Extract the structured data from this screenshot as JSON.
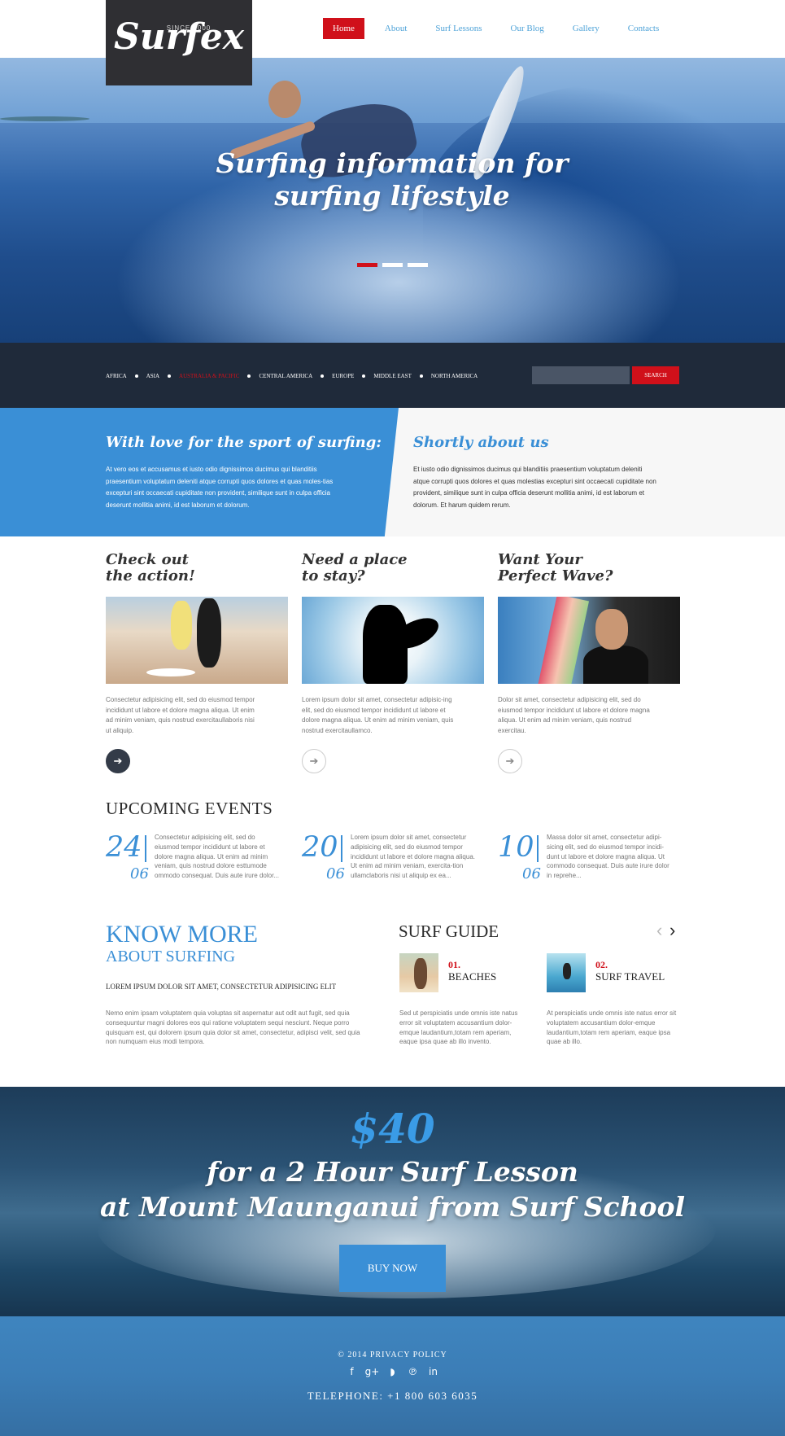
{
  "logo": {
    "since": "SINCE 2000",
    "brand": "Surfex"
  },
  "nav": {
    "items": [
      {
        "label": "Home",
        "active": true
      },
      {
        "label": "About"
      },
      {
        "label": "Surf Lessons"
      },
      {
        "label": "Our Blog"
      },
      {
        "label": "Gallery"
      },
      {
        "label": "Contacts"
      }
    ]
  },
  "hero": {
    "line1": "Surfing information for",
    "line2": "surfing lifestyle",
    "slides": 3,
    "active_slide": 1
  },
  "regions": {
    "items": [
      {
        "label": "AFRICA"
      },
      {
        "label": "ASIA"
      },
      {
        "label": "AUSTRALIA & PACIFIC",
        "active": true
      },
      {
        "label": "CENTRAL AMERICA"
      },
      {
        "label": "EUROPE"
      },
      {
        "label": "MIDDLE EAST"
      },
      {
        "label": "NORTH AMERICA"
      }
    ],
    "search_placeholder": "",
    "search_label": "SEARCH"
  },
  "info": {
    "left_title": "With love for the sport of surfing:",
    "left_text": "At vero eos et accusamus et iusto odio dignissimos ducimus qui blanditiis praesentium voluptatum deleniti atque corrupti quos dolores et quas moles-tias excepturi sint occaecati cupiditate non provident, similique sunt in culpa officia deserunt mollitia animi, id est laborum et dolorum.",
    "right_title": "Shortly about us",
    "right_text": "Et iusto odio dignissimos ducimus qui blanditiis praesentium voluptatum deleniti atque corrupti quos dolores et quas molestias excepturi sint occaecati cupiditate non provident, similique sunt in culpa officia deserunt mollitia animi, id est laborum et dolorum. Et harum quidem rerum."
  },
  "features": [
    {
      "title1": "Check out",
      "title2": "the action!",
      "text": "Consectetur adipisicing elit, sed do eiusmod tempor incididunt ut labore et dolore magna aliqua. Ut enim ad minim veniam, quis nostrud exercitaullaboris nisi ut aliquip."
    },
    {
      "title1": "Need a place",
      "title2": "to stay?",
      "text": "Lorem ipsum dolor sit amet, consectetur adipisic-ing elit, sed do eiusmod tempor incididunt ut labore et dolore magna aliqua. Ut enim ad minim veniam, quis nostrud exercitaullamco."
    },
    {
      "title1": "Want Your",
      "title2": "Perfect Wave?",
      "text": "Dolor sit amet, consectetur adipisicing elit, sed do eiusmod tempor incididunt ut labore et dolore magna aliqua. Ut enim ad minim veniam, quis nostrud exercitau."
    }
  ],
  "events": {
    "title": "UPCOMING EVENTS",
    "items": [
      {
        "day": "24",
        "month": "06",
        "text": "Consectetur adipisicing elit, sed do eiusmod tempor incididunt ut labore et dolore magna aliqua. Ut enim ad minim veniam, quis nostrud dolore esttumode ommodo consequat. Duis aute irure dolor..."
      },
      {
        "day": "20",
        "month": "06",
        "text": "Lorem ipsum dolor sit amet, consectetur adipisicing elit, sed do eiusmod tempor incididunt ut labore et dolore magna aliqua. Ut enim ad minim veniam, exercita-tion ullamclaboris nisi ut aliquip ex ea..."
      },
      {
        "day": "10",
        "month": "06",
        "text": "Massa dolor sit amet, consectetur adipi-sicing elit, sed do eiusmod tempor incidi-dunt ut labore et dolore magna aliqua. Ut commodo consequat. Duis aute irure dolor in reprehe..."
      }
    ]
  },
  "know_more": {
    "title1": "KNOW MORE",
    "title2": "ABOUT SURFING",
    "subtitle": "LOREM IPSUM DOLOR SIT AMET, CONSECTETUR ADIPISICING ELIT",
    "text": "Nemo enim ipsam voluptatem quia voluptas sit aspernatur aut odit aut fugit, sed quia consequuntur magni dolores eos qui ratione voluptatem sequi nesciunt. Neque porro quisquam est, qui dolorem ipsum quia dolor sit amet, consectetur, adipisci velit, sed quia non numquam eius modi tempora."
  },
  "surf_guide": {
    "title": "SURF GUIDE",
    "prev": "‹",
    "next": "›",
    "items": [
      {
        "num": "01.",
        "name": "BEACHES",
        "text": "Sed ut perspiciatis unde omnis iste natus error sit voluptatem accusantium dolor-emque laudantium,totam rem aperiam, eaque ipsa quae ab illo invento."
      },
      {
        "num": "02.",
        "name": "SURF TRAVEL",
        "text": "At perspiciatis unde omnis iste natus error sit voluptatem accusantium dolor-emque laudantium,totam rem aperiam, eaque ipsa quae ab illo."
      }
    ]
  },
  "promo": {
    "price": "$40",
    "line1": "for a 2 Hour Surf Lesson",
    "line2": "at Mount Maunganui from Surf School",
    "button": "BUY NOW"
  },
  "footer": {
    "copyright": "© 2014 PRIVACY POLICY",
    "socials": [
      {
        "icon": "facebook-icon",
        "glyph": "f"
      },
      {
        "icon": "google-plus-icon",
        "glyph": "g+"
      },
      {
        "icon": "rss-icon",
        "glyph": "◗"
      },
      {
        "icon": "pinterest-icon",
        "glyph": "℗"
      },
      {
        "icon": "linkedin-icon",
        "glyph": "in"
      }
    ],
    "telephone": "TELEPHONE:  +1 800 603 6035"
  },
  "colors": {
    "accent_blue": "#3a8fd6",
    "accent_red": "#d0101a",
    "dark": "#2f2f33"
  }
}
